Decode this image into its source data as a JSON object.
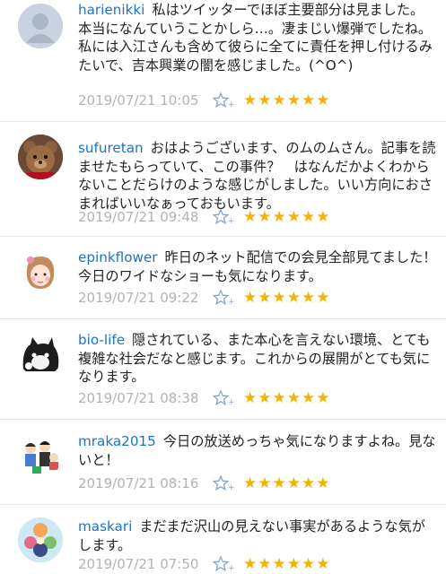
{
  "comments": [
    {
      "user": "harienikki",
      "text": "私はツイッターでほぼ主要部分は見ました。本当になんていうことかしら…。凄まじい爆弾でしたね。私には入江さんも含めて彼らに全てに責任を押し付けるみたいで、吉本興業の闇を感じました。(^O^)",
      "date": "2019/07/21 10:05",
      "rating": "★★★★★★",
      "avatar_icon": "default-person-icon"
    },
    {
      "user": "sufuretan",
      "text": "おはようございます、のムのムさん。記事を読ませたもらっていて、この事件？　はなんだかよくわからないことだらけのような感じがしました。いい方向におさまればいいなぁっておもいます。",
      "date": "2019/07/21 09:48",
      "rating": "★★★★★★",
      "avatar_icon": "teddy-bear-icon"
    },
    {
      "user": "epinkflower",
      "text": "昨日のネット配信での会見全部見てました！今日のワイドなショーも気になります。",
      "date": "2019/07/21 09:22",
      "rating": "★★★★★★",
      "avatar_icon": "girl-illustration-icon"
    },
    {
      "user": "bio-life",
      "text": "隠されている、また本心を言えない環境、とても複雑な社会だなと感じます。これからの展開がとても気になります。",
      "date": "2019/07/21 08:38",
      "rating": "★★★★★★",
      "avatar_icon": "cat-icon"
    },
    {
      "user": "mraka2015",
      "text": "今日の放送めっちゃ気になりますよね。見ないと！",
      "date": "2019/07/21 08:16",
      "rating": "★★★★★★",
      "avatar_icon": "family-illustration-icon"
    },
    {
      "user": "maskari",
      "text": "まだまだ沢山の見えない事実があるような気がします。",
      "date": "2019/07/21 07:50",
      "rating": "★★★★★★",
      "avatar_icon": "floral-icon"
    }
  ],
  "colors": {
    "username": "#1a73c9",
    "star": "#f2b400",
    "meta": "#b3b3b3"
  }
}
